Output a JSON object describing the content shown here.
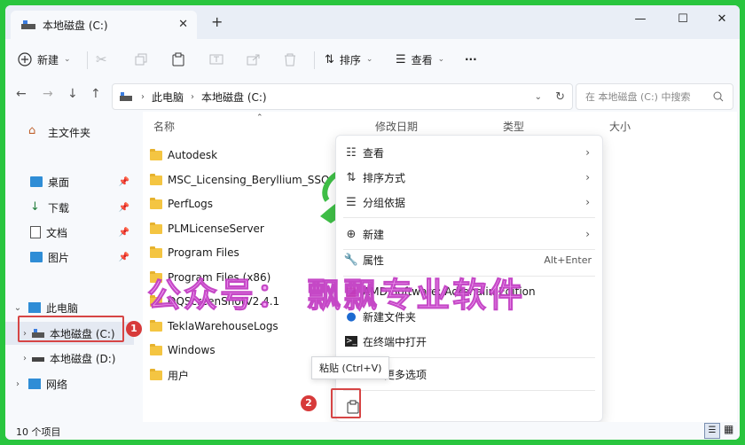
{
  "window": {
    "tab_title": "本地磁盘 (C:)",
    "controls": {
      "minimize": "—",
      "maximize": "☐",
      "close": "✕"
    }
  },
  "toolbar": {
    "new_label": "新建",
    "sort_label": "排序",
    "view_label": "查看",
    "more_label": "···"
  },
  "address": {
    "crumbs": [
      "此电脑",
      "本地磁盘 (C:)"
    ],
    "search_placeholder": "在 本地磁盘 (C:) 中搜索"
  },
  "sidebar": {
    "home": "主文件夹",
    "quick": [
      {
        "label": "桌面"
      },
      {
        "label": "下载"
      },
      {
        "label": "文档"
      },
      {
        "label": "图片"
      }
    ],
    "this_pc": "此电脑",
    "drive_c": "本地磁盘 (C:)",
    "drive_d": "本地磁盘 (D:)",
    "network": "网络"
  },
  "columns": {
    "name": "名称",
    "date": "修改日期",
    "type": "类型",
    "size": "大小"
  },
  "files": [
    "Autodesk",
    "MSC_Licensing_Beryllium_SSQ",
    "PerfLogs",
    "PLMLicenseServer",
    "Program Files",
    "Program Files (x86)",
    "QQScreenShotV2.4.1",
    "TeklaWarehouseLogs",
    "Windows",
    "用户"
  ],
  "context_menu": {
    "view": "查看",
    "sort": "排序方式",
    "group": "分组依据",
    "new": "新建",
    "properties": "属性",
    "properties_shortcut": "Alt+Enter",
    "amd": "AMD Software: Adrenalin Edition",
    "new_folder": "新建文件夹",
    "terminal": "在终端中打开",
    "more": "显示更多选项"
  },
  "tooltip": "粘贴 (Ctrl+V)",
  "status": "10 个项目",
  "watermark": "公众号： 飘飘专业软件",
  "badges": [
    "1",
    "2"
  ],
  "colors": {
    "frame": "#29c53e",
    "badge": "#d73a3a",
    "folder": "#f4c542",
    "watermark": "#f4a0f7"
  }
}
